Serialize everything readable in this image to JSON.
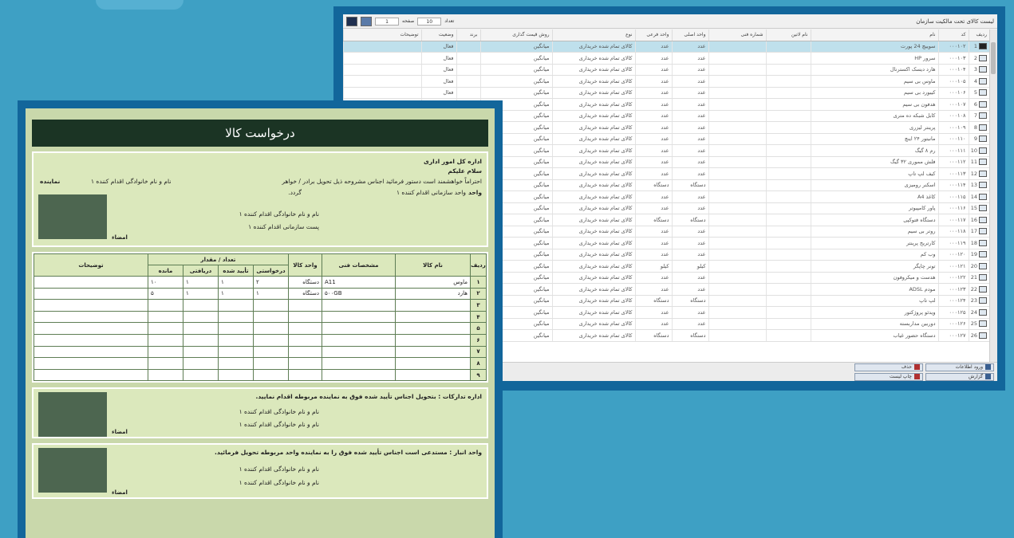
{
  "list_window": {
    "title": "لیست کالای تحت مالکیت سازمان",
    "toolbar": {
      "field1": "1",
      "label1": "صفحه",
      "field2": "10",
      "label2": "تعداد"
    },
    "columns": [
      "ردیف",
      "کد",
      "نام",
      "نام لاتین",
      "شماره فنی",
      "واحد اصلی",
      "واحد فرعی",
      "نوع",
      "روش قیمت گذاری",
      "برند",
      "وضعیت",
      "توضیحات"
    ],
    "rows": [
      [
        "1",
        "۰۰۰۱۰۲",
        "سوییچ 24 پورت",
        "عدد",
        "عدد",
        "کالای تمام شده خریداری",
        "میانگین",
        "فعال"
      ],
      [
        "2",
        "۰۰۰۱۰۳",
        "سرور HP",
        "عدد",
        "عدد",
        "کالای تمام شده خریداری",
        "میانگین",
        "فعال"
      ],
      [
        "3",
        "۰۰۰۱۰۴",
        "هارد دیسک اکسترنال",
        "عدد",
        "عدد",
        "کالای تمام شده خریداری",
        "میانگین",
        "فعال"
      ],
      [
        "4",
        "۰۰۰۱۰۵",
        "ماوس بی سیم",
        "عدد",
        "عدد",
        "کالای تمام شده خریداری",
        "میانگین",
        "فعال"
      ],
      [
        "5",
        "۰۰۰۱۰۶",
        "کیبورد بی سیم",
        "عدد",
        "عدد",
        "کالای تمام شده خریداری",
        "میانگین",
        "فعال"
      ],
      [
        "6",
        "۰۰۰۱۰۷",
        "هدفون بی سیم",
        "عدد",
        "عدد",
        "کالای تمام شده خریداری",
        "میانگین",
        ""
      ],
      [
        "7",
        "۰۰۰۱۰۸",
        "کابل شبکه ده متری",
        "عدد",
        "عدد",
        "کالای تمام شده خریداری",
        "میانگین",
        ""
      ],
      [
        "8",
        "۰۰۰۱۰۹",
        "پرینتر لیزری",
        "عدد",
        "عدد",
        "کالای تمام شده خریداری",
        "میانگین",
        ""
      ],
      [
        "9",
        "۰۰۰۱۱۰",
        "مانیتور ۲۴ اینچ",
        "عدد",
        "عدد",
        "کالای تمام شده خریداری",
        "میانگین",
        ""
      ],
      [
        "10",
        "۰۰۰۱۱۱",
        "رم ۸ گیگ",
        "عدد",
        "عدد",
        "کالای تمام شده خریداری",
        "میانگین",
        ""
      ],
      [
        "11",
        "۰۰۰۱۱۲",
        "فلش مموری ۳۲ گیگ",
        "عدد",
        "عدد",
        "کالای تمام شده خریداری",
        "میانگین",
        ""
      ],
      [
        "12",
        "۰۰۰۱۱۳",
        "کیف لپ تاپ",
        "عدد",
        "عدد",
        "کالای تمام شده خریداری",
        "میانگین",
        ""
      ],
      [
        "13",
        "۰۰۰۱۱۴",
        "اسکنر رومیزی",
        "دستگاه",
        "دستگاه",
        "کالای تمام شده خریداری",
        "میانگین",
        ""
      ],
      [
        "14",
        "۰۰۰۱۱۵",
        "کاغذ A4",
        "عدد",
        "عدد",
        "کالای تمام شده خریداری",
        "میانگین",
        ""
      ],
      [
        "15",
        "۰۰۰۱۱۶",
        "پاور کامپیوتر",
        "عدد",
        "عدد",
        "کالای تمام شده خریداری",
        "میانگین",
        ""
      ],
      [
        "16",
        "۰۰۰۱۱۷",
        "دستگاه فتوکپی",
        "دستگاه",
        "دستگاه",
        "کالای تمام شده خریداری",
        "میانگین",
        ""
      ],
      [
        "17",
        "۰۰۰۱۱۸",
        "روتر بی سیم",
        "عدد",
        "عدد",
        "کالای تمام شده خریداری",
        "میانگین",
        ""
      ],
      [
        "18",
        "۰۰۰۱۱۹",
        "کارتریج پرینتر",
        "عدد",
        "عدد",
        "کالای تمام شده خریداری",
        "میانگین",
        ""
      ],
      [
        "19",
        "۰۰۰۱۲۰",
        "وب کم",
        "عدد",
        "عدد",
        "کالای تمام شده خریداری",
        "میانگین",
        ""
      ],
      [
        "20",
        "۰۰۰۱۲۱",
        "تونر چاپگر",
        "کیلو",
        "کیلو",
        "کالای تمام شده خریداری",
        "میانگین",
        ""
      ],
      [
        "21",
        "۰۰۰۱۲۲",
        "هدست و میکروفون",
        "عدد",
        "عدد",
        "کالای تمام شده خریداری",
        "میانگین",
        ""
      ],
      [
        "22",
        "۰۰۰۱۲۳",
        "مودم ADSL",
        "عدد",
        "عدد",
        "کالای تمام شده خریداری",
        "میانگین",
        ""
      ],
      [
        "23",
        "۰۰۰۱۲۴",
        "لپ تاپ",
        "دستگاه",
        "دستگاه",
        "کالای تمام شده خریداری",
        "میانگین",
        ""
      ],
      [
        "24",
        "۰۰۰۱۲۵",
        "ویدئو پروژکتور",
        "عدد",
        "عدد",
        "کالای تمام شده خریداری",
        "میانگین",
        ""
      ],
      [
        "25",
        "۰۰۰۱۲۶",
        "دوربین مداربسته",
        "عدد",
        "عدد",
        "کالای تمام شده خریداری",
        "میانگین",
        ""
      ],
      [
        "26",
        "۰۰۰۱۲۷",
        "دستگاه حضور غیاب",
        "دستگاه",
        "دستگاه",
        "کالای تمام شده خریداری",
        "میانگین",
        ""
      ]
    ],
    "footer": {
      "btn1": "ورود اطلاعات",
      "btn2": "حذف",
      "btn3": "گزارش",
      "btn4": "چاپ لیست"
    }
  },
  "form_window": {
    "title": "درخواست کالا",
    "header": {
      "line1": "اداره کل امور اداری",
      "line2": "سلام علیکم",
      "line3": "احتراماً خواهشمند است دستور فرمائید اجناس مشروحه ذیل تحویل برادر / خواهر",
      "line3b": "نام و نام خانوادگی اقدام کننده ۱",
      "side_label": "نماینده",
      "unit_label": "واحد",
      "unit_value": "واحد سازمانی اقدام کننده ۱",
      "gardad": "گردد.",
      "name_line": "نام و نام خانوادگی اقدام کننده ۱",
      "post_line": "پست سازمانی اقدام کننده ۱",
      "sign": "امضاء"
    },
    "table": {
      "h_row": "ردیف",
      "h_name": "نام کالا",
      "h_spec": "مشخصات فنی",
      "h_unit": "واحد کالا",
      "h_qty_group": "تعداد / مقدار",
      "h_req": "درخواستی",
      "h_approved": "تأیید شده",
      "h_received": "دریافتی",
      "h_remaining": "مانده",
      "h_notes": "توضیحات",
      "rows": [
        {
          "n": "۱",
          "name": "ماوس",
          "spec": "A11",
          "unit": "دستگاه",
          "req": "۲",
          "app": "۱",
          "rec": "۱",
          "rem": "۱۰",
          "notes": ""
        },
        {
          "n": "۲",
          "name": "هارد",
          "spec": "۵۰۰GB",
          "unit": "دستگاه",
          "req": "۱",
          "app": "۱",
          "rec": "۱",
          "rem": "۵",
          "notes": ""
        },
        {
          "n": "۳",
          "name": "",
          "spec": "",
          "unit": "",
          "req": "",
          "app": "",
          "rec": "",
          "rem": "",
          "notes": ""
        },
        {
          "n": "۴",
          "name": "",
          "spec": "",
          "unit": "",
          "req": "",
          "app": "",
          "rec": "",
          "rem": "",
          "notes": ""
        },
        {
          "n": "۵",
          "name": "",
          "spec": "",
          "unit": "",
          "req": "",
          "app": "",
          "rec": "",
          "rem": "",
          "notes": ""
        },
        {
          "n": "۶",
          "name": "",
          "spec": "",
          "unit": "",
          "req": "",
          "app": "",
          "rec": "",
          "rem": "",
          "notes": ""
        },
        {
          "n": "۷",
          "name": "",
          "spec": "",
          "unit": "",
          "req": "",
          "app": "",
          "rec": "",
          "rem": "",
          "notes": ""
        },
        {
          "n": "۸",
          "name": "",
          "spec": "",
          "unit": "",
          "req": "",
          "app": "",
          "rec": "",
          "rem": "",
          "notes": ""
        },
        {
          "n": "۹",
          "name": "",
          "spec": "",
          "unit": "",
          "req": "",
          "app": "",
          "rec": "",
          "rem": "",
          "notes": ""
        }
      ]
    },
    "section_a": {
      "line1": "اداره تدارکات : بتحویل اجناس تأیید شده فوق به نماینده مربوطه اقدام نمایید.",
      "line2": "نام و نام خانوادگی اقدام کننده ۱",
      "line3": "نام و نام خانوادگی اقدام کننده ۱",
      "sign": "امضاء"
    },
    "section_b": {
      "line1": "واحد انبار : مستدعی است اجناس تأیید شده فوق را به نماینده واحد مربوطه تحویل فرمائید.",
      "line2": "نام و نام خانوادگی اقدام کننده ۱",
      "line3": "نام و نام خانوادگی اقدام کننده ۱",
      "sign": "امضاء"
    }
  }
}
